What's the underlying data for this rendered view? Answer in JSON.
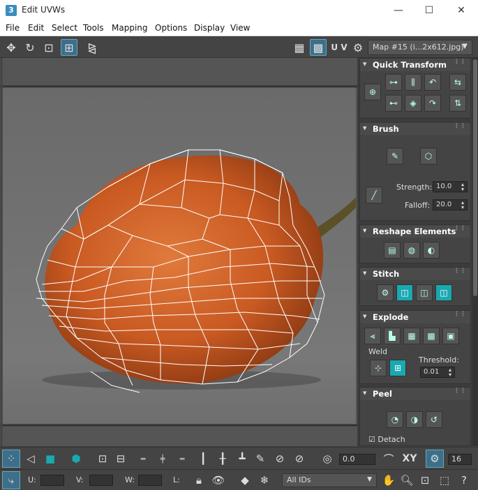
{
  "window": {
    "title": "Edit UVWs",
    "app_icon": "3",
    "minimize": "—",
    "maximize": "☐",
    "close": "✕"
  },
  "menu": [
    "File",
    "Edit",
    "Select",
    "Tools",
    "Mapping",
    "Options",
    "Display",
    "View"
  ],
  "toolbar": {
    "uv_label": "U V",
    "map_select": "Map #15 (i...2x612.jpg)"
  },
  "panel": {
    "quick_transform": {
      "title": "Quick Transform"
    },
    "brush": {
      "title": "Brush",
      "strength_label": "Strength:",
      "strength_value": "10.0",
      "falloff_label": "Falloff:",
      "falloff_value": "20.0"
    },
    "reshape": {
      "title": "Reshape Elements"
    },
    "stitch": {
      "title": "Stitch"
    },
    "explode": {
      "title": "Explode",
      "weld_label": "Weld",
      "threshold_label": "Threshold:",
      "threshold_value": "0.01"
    },
    "peel": {
      "title": "Peel",
      "detach_label": "Detach",
      "detach_checked": true
    }
  },
  "bottom": {
    "rotate_value": "0.0",
    "xy_label": "XY",
    "count_value": "16",
    "u_label": "U:",
    "v_label": "V:",
    "w_label": "W:",
    "l_label": "L:",
    "u_value": "",
    "v_value": "",
    "w_value": "",
    "ids_select": "All IDs"
  },
  "colors": {
    "accent": "#19a9b0",
    "pepper": "#d0602a",
    "background": "#5a5a5a"
  }
}
